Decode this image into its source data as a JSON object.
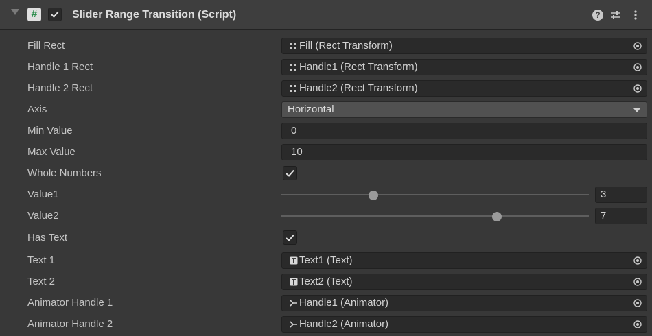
{
  "header": {
    "title": "Slider Range Transition (Script)",
    "script_icon_glyph": "#",
    "icons": [
      "foldout-arrow-icon",
      "script-icon",
      "checkbox-icon",
      "help-icon",
      "presets-icon",
      "menu-icon"
    ]
  },
  "fields": {
    "fill_rect": {
      "label": "Fill Rect",
      "value": "Fill (Rect Transform)",
      "icon": "rect-transform-icon"
    },
    "handle1_rect": {
      "label": "Handle 1 Rect",
      "value": "Handle1 (Rect Transform)",
      "icon": "rect-transform-icon"
    },
    "handle2_rect": {
      "label": "Handle 2 Rect",
      "value": "Handle2 (Rect Transform)",
      "icon": "rect-transform-icon"
    },
    "axis": {
      "label": "Axis",
      "value": "Horizontal"
    },
    "min_value": {
      "label": "Min Value",
      "value": "0"
    },
    "max_value": {
      "label": "Max Value",
      "value": "10"
    },
    "whole_numbers": {
      "label": "Whole Numbers",
      "checked": true
    },
    "value1": {
      "label": "Value1",
      "value": "3",
      "fraction": 0.3
    },
    "value2": {
      "label": "Value2",
      "value": "7",
      "fraction": 0.7
    },
    "has_text": {
      "label": "Has Text",
      "checked": true
    },
    "text1": {
      "label": "Text 1",
      "value": "Text1 (Text)",
      "icon": "text-component-icon"
    },
    "text2": {
      "label": "Text 2",
      "value": "Text2 (Text)",
      "icon": "text-component-icon"
    },
    "animator_handle1": {
      "label": "Animator Handle 1",
      "value": "Handle1 (Animator)",
      "icon": "animator-icon"
    },
    "animator_handle2": {
      "label": "Animator Handle 2",
      "value": "Handle2 (Animator)",
      "icon": "animator-icon"
    }
  },
  "colors": {
    "background": "#383838",
    "header_bg": "#3e3e3e",
    "field_bg": "#2a2a2a",
    "dropdown_bg": "#515151",
    "text": "#c4c4c4"
  }
}
